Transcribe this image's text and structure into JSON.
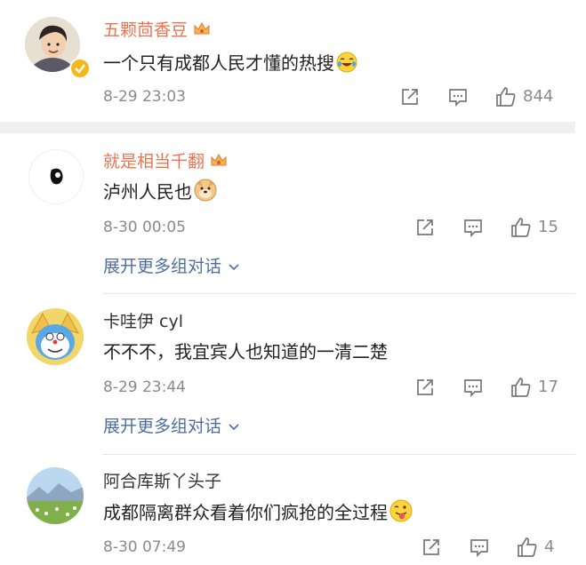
{
  "comments": [
    {
      "name": "五颗茴香豆",
      "text": "一个只有成都人民才懂的热搜",
      "emoji": "laugh-cry-emoji",
      "time": "8-29 23:03",
      "likes": "844",
      "vip": true,
      "verified": true
    },
    {
      "name": "就是相当千翻",
      "text": "泸州人民也",
      "emoji": "doge-emoji",
      "time": "8-30 00:05",
      "likes": "15",
      "vip": true,
      "more": "展开更多组对话"
    },
    {
      "name": "卡哇伊 cyl",
      "text": "不不不，我宜宾人也知道的一清二楚",
      "time": "8-29 23:44",
      "likes": "17",
      "vip": false,
      "more": "展开更多组对话"
    },
    {
      "name": "阿合库斯丫头子",
      "text": "成都隔离群众看着你们疯抢的全过程",
      "emoji": "tongue-out-emoji",
      "time": "8-30 07:49",
      "likes": "4",
      "vip": false
    }
  ],
  "icons": {
    "repost": "repost-icon",
    "comment": "comment-icon",
    "like": "thumbs-up-icon",
    "expand": "chevron-down-icon"
  },
  "colors": {
    "vip_name": "#eb7350",
    "link": "#4e6ea0",
    "meta": "#8a8a8a"
  }
}
